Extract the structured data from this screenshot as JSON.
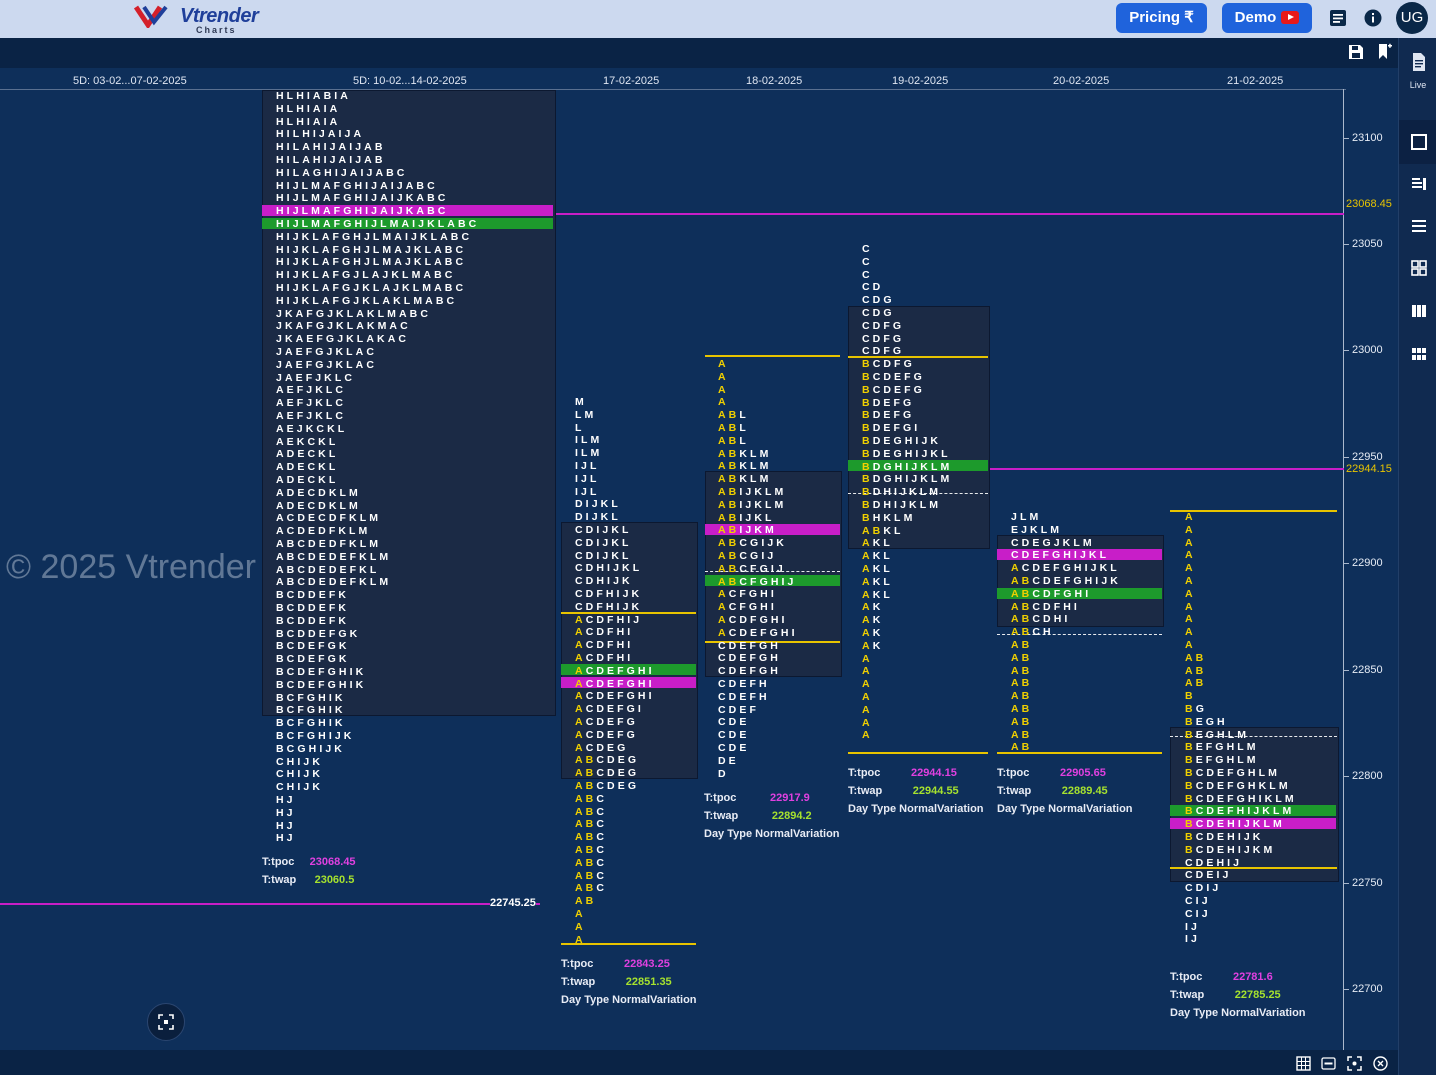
{
  "app": {
    "brand": "Vtrender",
    "brand_sub": "Charts"
  },
  "header": {
    "pricing_label": "Pricing ₹",
    "demo_label": "Demo",
    "user_initials": "UG"
  },
  "sidepanel": {
    "live_label": "Live"
  },
  "watermark": "© 2025 Vtrender",
  "dates": [
    "5D: 03-02...07-02-2025",
    "5D: 10-02...14-02-2025",
    "17-02-2025",
    "18-02-2025",
    "19-02-2025",
    "20-02-2025",
    "21-02-2025"
  ],
  "axis": {
    "ticks": [
      "23100",
      "23050",
      "23000",
      "22950",
      "22900",
      "22850",
      "22800",
      "22750",
      "22700"
    ]
  },
  "price_tags": {
    "tag1": "23068.45",
    "tag2": "22944.15",
    "tag3": "22745.25"
  },
  "colors": {
    "poc": "#c81ec8",
    "va": "#e8c400",
    "green": "#1d9a2c",
    "background": "#0e2f5a"
  },
  "labels": {
    "tpoc": "T:tpoc",
    "twap": "T:twap",
    "daytype": "Day Type"
  },
  "profiles": [
    {
      "id": "p0",
      "tpoc": "23068.45",
      "twap": "23060.5",
      "daytype": ""
    },
    {
      "id": "p1",
      "tpoc": "22843.25",
      "twap": "22851.35",
      "daytype": "NormalVariation"
    },
    {
      "id": "p2",
      "tpoc": "22917.9",
      "twap": "22894.2",
      "daytype": "NormalVariation"
    },
    {
      "id": "p3",
      "tpoc": "22944.15",
      "twap": "22944.55",
      "daytype": "NormalVariation"
    },
    {
      "id": "p4",
      "tpoc": "22905.65",
      "twap": "22889.45",
      "daytype": "NormalVariation"
    },
    {
      "id": "p5",
      "tpoc": "22781.6",
      "twap": "22785.25",
      "daytype": "NormalVariation"
    }
  ],
  "tpo": {
    "p0": [
      "HLHIABIA",
      "HLHIAIA",
      "HLHIAIA",
      "HILHIJAIJA",
      "HILAHIJAIJAB",
      "HILAHIJAIJAB",
      "HILAGHIJAIJABC",
      "HIJLMAFGHIJAIJABC",
      "HIJLMAFGHIJAIJKABC",
      "HIJLMAFGHIJAIJKABC",
      "HIJLMAFGHIJLMAIJKLABC",
      "HIJKLAFGHJLMAIJKLABC",
      "HIJKLAFGHJLMAJKLABC",
      "HIJKLAFGHJLMAJKLABC",
      "HIJKLAFGJLAJKLMABC",
      "HIJKLAFGJKLAJKLMABC",
      "HIJKLAFGJKLAKLMABC",
      "JKAFGJKLAKLMABC",
      "JKAFGJKLAKMAC",
      "JKAEFGJKLAKAC",
      "JAEFGJKLAC",
      "JAEFGJKLAC",
      "JAEFJKLC",
      "AEFJKLC",
      "AEFJKLC",
      "AEFJKLC",
      "AEJKCKL",
      "AEKCKL",
      "ADECKL",
      "ADECKL",
      "ADECKL",
      "ADECDKLM",
      "ADECDKLM",
      "ACDECDFKLM",
      "ACDEDFKLM",
      "ABCDEDFKLM",
      "ABCDEDEFKLM",
      "ABCDEDEFKL",
      "ABCDEDEFKLM",
      "BCDDEFK",
      "BCDDEFK",
      "BCDDEFK",
      "BCDDEFGK",
      "BCDEFGK",
      "BCDEFGK",
      "BCDEFGHIK",
      "BCDEFGHIK",
      "BCFGHIK",
      "BCFGHIK",
      "BCFGHIK",
      "BCFGHIJK",
      "BCGHIJK",
      "CHIJK",
      "CHIJK",
      "CHIJK",
      "HJ",
      "HJ",
      "HJ",
      "HJ"
    ],
    "p1": [
      "M",
      "LM",
      "L",
      "ILM",
      "ILM",
      "IJL",
      "IJL",
      "IJL",
      "DIJKL",
      "DIJKL",
      "CDIJKL",
      "CDIJKL",
      "CDIJKL",
      "CDHIJKL",
      "CDHIJK",
      "CDFHIJK",
      "CDFHIJK",
      "ACDFHIJ",
      "ACDFHI",
      "ACDFHI",
      "ACDFHI",
      "ACDEFGHI",
      "ACDEFGHI",
      "ACDEFGHI",
      "ACDEFGI",
      "ACDEFG",
      "ACDEFG",
      "ACDEG",
      "ABCDEG",
      "ABCDEG",
      "ABCDEG",
      "ABC",
      "ABC",
      "ABC",
      "ABC",
      "ABC",
      "ABC",
      "ABC",
      "ABC",
      "AB",
      "A",
      "A",
      "A"
    ],
    "p2": [
      "A",
      "A",
      "A",
      "A",
      "ABL",
      "ABL",
      "ABL",
      "ABKLM",
      "ABKLM",
      "ABKLM",
      "ABIJKLM",
      "ABIJKLM",
      "ABIJKL",
      "ABIJKM",
      "ABCGIJK",
      "ABCGIJ",
      "ABCFGIJ",
      "ABCFGHIJ",
      "ACFGHI",
      "ACFGHI",
      "ACDFGHI",
      "ACDEFGHI",
      "CDEFGH",
      "CDEFGH",
      "CDEFGH",
      "CDEFH",
      "CDEFH",
      "CDEF",
      "CDE",
      "CDE",
      "CDE",
      "DE",
      "D"
    ],
    "p3": [
      "C",
      "C",
      "C",
      "CD",
      "CDG",
      "CDG",
      "CDFG",
      "CDFG",
      "CDFG",
      "BCDFG",
      "BCDEFG",
      "BCDEFG",
      "BDEFG",
      "BDEFG",
      "BDEFGI",
      "BDEGHIJK",
      "BDEGHIJKL",
      "BDGHIJKLM",
      "BDGHIJKLM",
      "BDHIJKLM",
      "BDHIJKLM",
      "BHKLM",
      "ABKL",
      "AKL",
      "AKL",
      "AKL",
      "AKL",
      "AKL",
      "AK",
      "AK",
      "AK",
      "AK",
      "A",
      "A",
      "A",
      "A",
      "A",
      "A",
      "A"
    ],
    "p4": [
      "JLM",
      "EJKLM",
      "CDEGJKLM",
      "CDEFGHIJKL",
      "ACDEFGHIJKL",
      "ABCDEFGHIJK",
      "ABCDFGHI",
      "ABCDFHI",
      "ABCDHI",
      "ABCH",
      "AB",
      "AB",
      "AB",
      "AB",
      "AB",
      "AB",
      "AB",
      "AB",
      "AB"
    ],
    "p5": [
      "A",
      "A",
      "A",
      "A",
      "A",
      "A",
      "A",
      "A",
      "A",
      "A",
      "A",
      "AB",
      "AB",
      "AB",
      "B",
      "BG",
      "BEGH",
      "BEGHLM",
      "BEFGHLM",
      "BEFGHLM",
      "BCDEFGHLM",
      "BCDEFGHKLM",
      "BCDEFGHIKLM",
      "BCDEFHIJKLM",
      "BCDEHIJKLM",
      "BCDEHIJK",
      "BCDEHIJKM",
      "CDEHIJ",
      "CDEIJ",
      "CDIJ",
      "CIJ",
      "CIJ",
      "IJ",
      "IJ"
    ]
  }
}
